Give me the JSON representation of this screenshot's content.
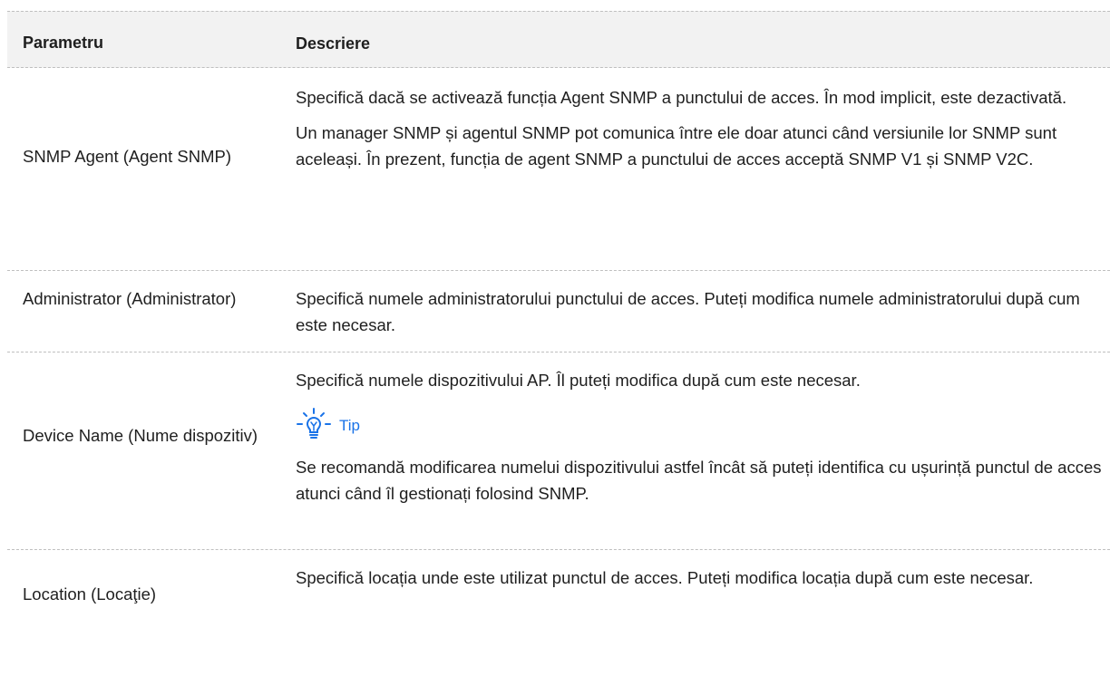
{
  "table": {
    "headers": {
      "param": "Parametru",
      "desc": "Descriere"
    },
    "rows": [
      {
        "param": "SNMP Agent (Agent SNMP)",
        "desc_p1": "Specifică dacă se activează funcția Agent SNMP a punctului de acces. În mod implicit, este dezactivată.",
        "desc_p2": "Un manager SNMP și agentul SNMP pot comunica între ele doar atunci când versiunile lor SNMP sunt aceleași. În prezent, funcția de agent SNMP a punctului de acces acceptă SNMP V1 și SNMP V2C."
      },
      {
        "param": "Administrator (Administrator)",
        "desc_p1": "Specifică numele administratorului punctului de acces. Puteți modifica numele administratorului după cum este necesar."
      },
      {
        "param": "Device Name (Nume dispozitiv)",
        "desc_p1": "Specifică numele dispozitivului AP. Îl puteți modifica după cum este necesar.",
        "tip_label": "Tip",
        "tip_text": "Se recomandă modificarea numelui dispozitivului astfel încât să puteți identifica cu ușurință punctul de acces atunci când îl gestionați folosind SNMP."
      },
      {
        "param": "Location (Locaţie)",
        "desc_p1": "Specifică locația unde este utilizat punctul de acces. Puteți modifica locația după cum este necesar."
      }
    ]
  },
  "colors": {
    "header_bg": "#f2f2f2",
    "tip_blue": "#1a73e8",
    "divider": "#bfbfbf"
  },
  "icons": {
    "tip": "lightbulb-icon"
  }
}
